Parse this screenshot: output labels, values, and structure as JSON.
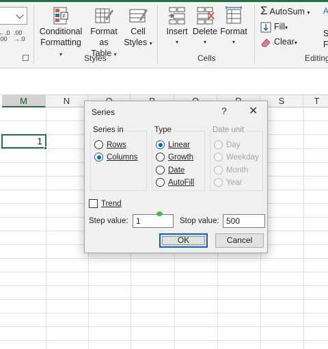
{
  "ribbon": {
    "number_format": {
      "increase_decimal": ".00\n.0",
      "decrease_decimal": ".00\n.0"
    },
    "styles": {
      "conditional_formatting": [
        "Conditional",
        "Formatting"
      ],
      "format_as_table": [
        "Format as",
        "Table"
      ],
      "cell_styles": [
        "Cell",
        "Styles"
      ],
      "group_label": "Styles"
    },
    "cells": {
      "insert": "Insert",
      "delete": "Delete",
      "format": "Format",
      "group_label": "Cells"
    },
    "editing": {
      "autosum": "AutoSum",
      "fill": "Fill",
      "clear": "Clear",
      "group_label": "Editing",
      "sort_partial": "S",
      "find_partial": "F"
    },
    "accent_color": "#1e7145"
  },
  "sheet": {
    "columns": [
      "M",
      "N",
      "O",
      "P",
      "Q",
      "R",
      "S",
      "T"
    ],
    "selected_column": "M",
    "active_cell_value": "1",
    "selection_color": "#217346"
  },
  "dialog": {
    "title": "Series",
    "help": "?",
    "close": "✕",
    "series_in": {
      "label": "Series in",
      "options": [
        "Rows",
        "Columns"
      ],
      "selected": "Columns"
    },
    "type": {
      "label": "Type",
      "options": [
        "Linear",
        "Growth",
        "Date",
        "AutoFill"
      ],
      "selected": "Linear"
    },
    "date_unit": {
      "label": "Date unit",
      "options": [
        "Day",
        "Weekday",
        "Month",
        "Year"
      ],
      "selected": "Day",
      "disabled": true
    },
    "trend": {
      "label": "Trend",
      "checked": false
    },
    "step_value": {
      "label": "Step value:",
      "value": "1"
    },
    "stop_value": {
      "label": "Stop value:",
      "value": "500"
    },
    "ok": "OK",
    "cancel": "Cancel",
    "accent_color": "#0a64c8"
  }
}
